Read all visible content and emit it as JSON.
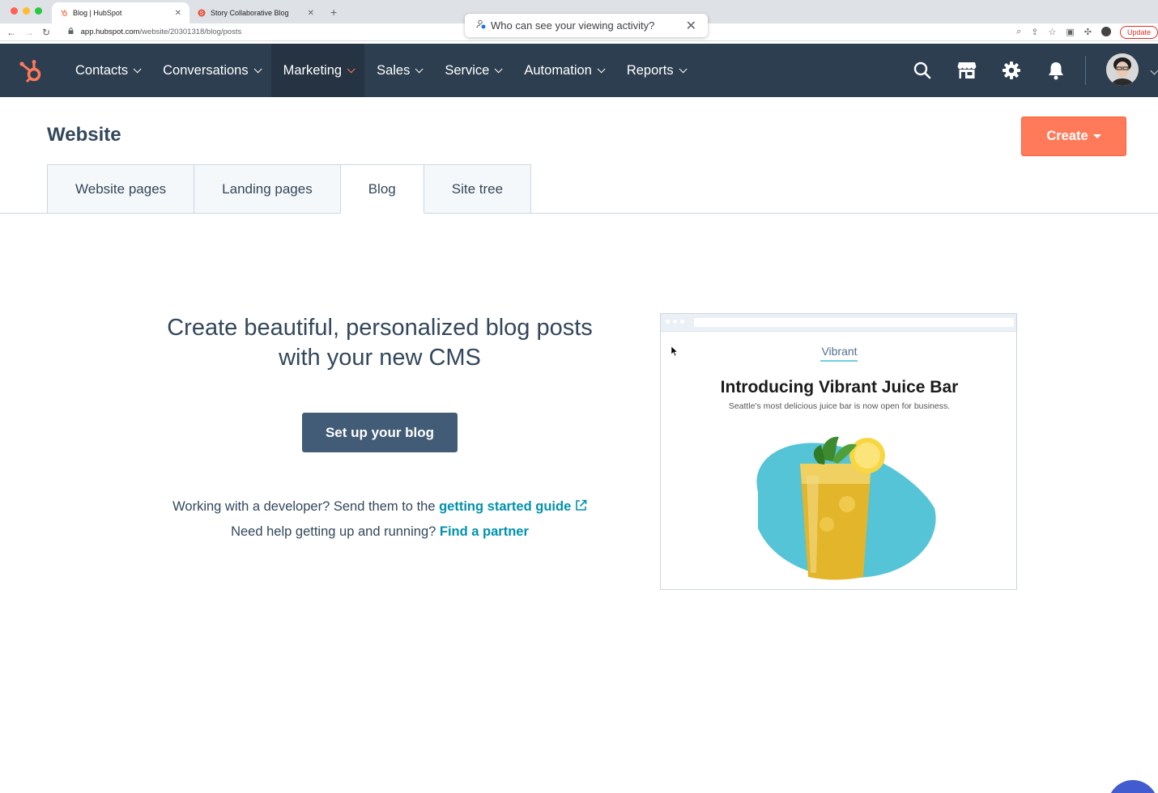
{
  "browser": {
    "tabs": [
      {
        "title": "Blog | HubSpot",
        "active": true
      },
      {
        "title": "Story Collaborative Blog",
        "active": false
      }
    ],
    "url_host": "app.hubspot.com",
    "url_path": "/website/20301318/blog/posts",
    "update_label": "Update",
    "popup_text": "Who can see your viewing activity?"
  },
  "nav": {
    "items": [
      {
        "label": "Contacts"
      },
      {
        "label": "Conversations"
      },
      {
        "label": "Marketing",
        "active": true
      },
      {
        "label": "Sales"
      },
      {
        "label": "Service"
      },
      {
        "label": "Automation"
      },
      {
        "label": "Reports"
      }
    ],
    "icons": [
      "search-icon",
      "marketplace-icon",
      "settings-icon",
      "notifications-icon"
    ]
  },
  "page": {
    "title": "Website",
    "create_label": "Create",
    "tabs": [
      {
        "label": "Website pages"
      },
      {
        "label": "Landing pages"
      },
      {
        "label": "Blog",
        "active": true
      },
      {
        "label": "Site tree"
      }
    ]
  },
  "content": {
    "headline_line1": "Create beautiful, personalized blog posts",
    "headline_line2": "with your new CMS",
    "setup_label": "Set up your blog",
    "help_line1_prefix": "Working with a developer? Send them to the ",
    "help_line1_link": "getting started guide",
    "help_line2_prefix": "Need help getting up and running? ",
    "help_line2_link": "Find a partner"
  },
  "preview": {
    "brand": "Vibrant",
    "title": "Introducing Vibrant Juice Bar",
    "subtitle": "Seattle's most delicious juice bar is now open for business."
  },
  "colors": {
    "nav_bg": "#2d3e50",
    "accent": "#ff7a59",
    "link": "#0091ae",
    "primary_dark": "#425b76"
  }
}
